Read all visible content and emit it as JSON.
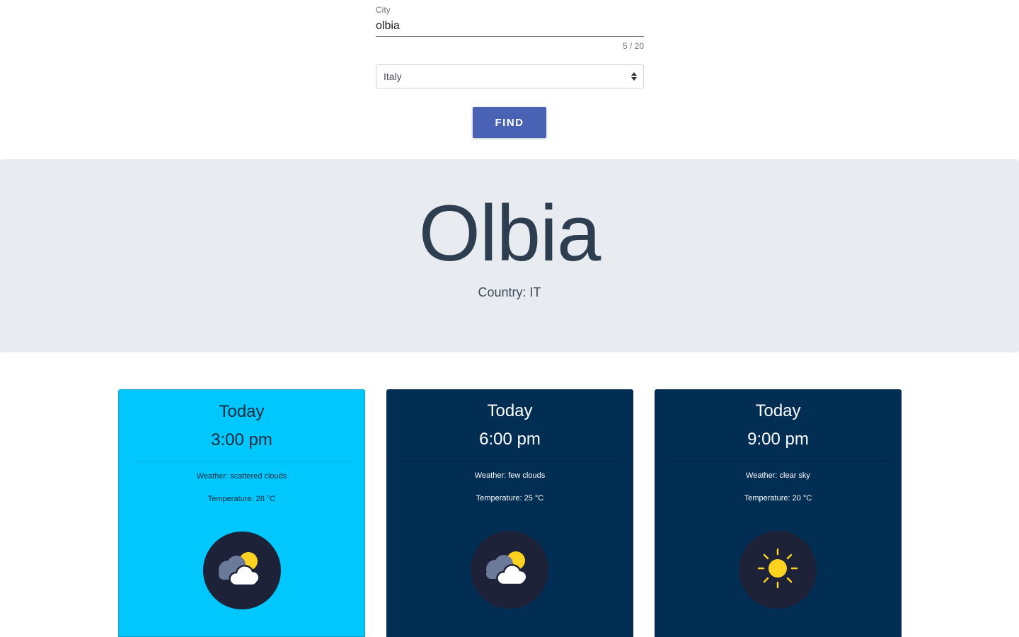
{
  "search": {
    "city_label": "City",
    "city_value": "olbia",
    "city_counter": "5 / 20",
    "country_selected": "Italy",
    "find_label": "FIND"
  },
  "location": {
    "city": "Olbia",
    "country_line": "Country: IT"
  },
  "forecast": [
    {
      "day": "Today",
      "time": "3:00 pm",
      "weather": "Weather: scattered clouds",
      "temperature": "Temperature: 28 °C",
      "icon": "partly-cloudy-icon",
      "active": true
    },
    {
      "day": "Today",
      "time": "6:00 pm",
      "weather": "Weather: few clouds",
      "temperature": "Temperature: 25 °C",
      "icon": "partly-cloudy-icon",
      "active": false
    },
    {
      "day": "Today",
      "time": "9:00 pm",
      "weather": "Weather: clear sky",
      "temperature": "Temperature: 20 °C",
      "icon": "sun-icon",
      "active": false
    }
  ],
  "colors": {
    "active_card": "#00c8ff",
    "dark_card": "#032e54",
    "find_button": "#4a62b3",
    "hero_bg": "#e8ebef",
    "icon_circle": "#1d2238",
    "sun": "#ffd21f"
  }
}
